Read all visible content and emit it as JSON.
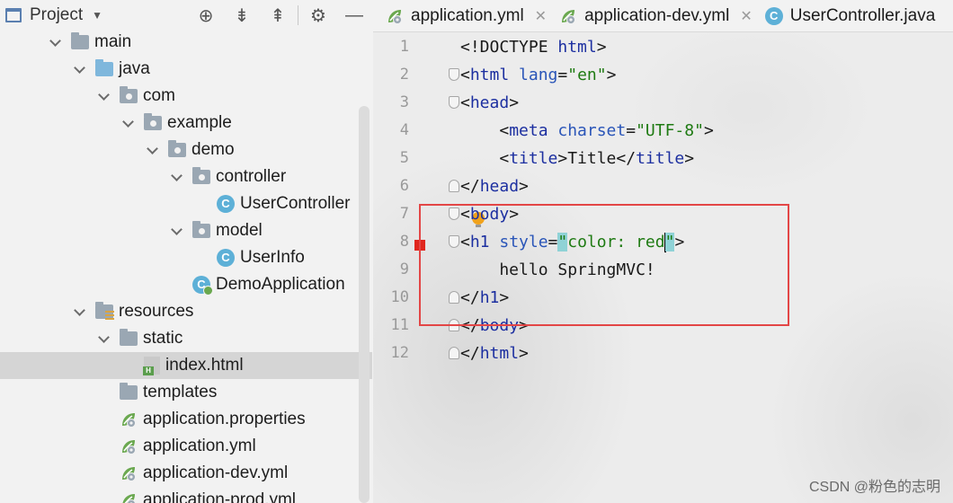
{
  "project_panel": {
    "title": "Project",
    "tree": [
      {
        "label": "main",
        "icon": "folder-icon",
        "indent": 1,
        "expanded": true
      },
      {
        "label": "java",
        "icon": "source-folder-icon",
        "indent": 2,
        "expanded": true
      },
      {
        "label": "com",
        "icon": "package-icon",
        "indent": 3,
        "expanded": true
      },
      {
        "label": "example",
        "icon": "package-icon",
        "indent": 4,
        "expanded": true
      },
      {
        "label": "demo",
        "icon": "package-icon",
        "indent": 5,
        "expanded": true
      },
      {
        "label": "controller",
        "icon": "package-icon",
        "indent": 6,
        "expanded": true
      },
      {
        "label": "UserController",
        "icon": "class-icon",
        "indent": 7
      },
      {
        "label": "model",
        "icon": "package-icon",
        "indent": 6,
        "expanded": true
      },
      {
        "label": "UserInfo",
        "icon": "class-icon",
        "indent": 7
      },
      {
        "label": "DemoApplication",
        "icon": "spring-boot-class-icon",
        "indent": 6
      },
      {
        "label": "resources",
        "icon": "resources-folder-icon",
        "indent": 2,
        "expanded": true
      },
      {
        "label": "static",
        "icon": "folder-icon",
        "indent": 3,
        "expanded": true
      },
      {
        "label": "index.html",
        "icon": "html-file-icon",
        "indent": 4,
        "selected": true
      },
      {
        "label": "templates",
        "icon": "folder-icon",
        "indent": 3
      },
      {
        "label": "application.properties",
        "icon": "spring-config-icon",
        "indent": 3
      },
      {
        "label": "application.yml",
        "icon": "spring-config-icon",
        "indent": 3
      },
      {
        "label": "application-dev.yml",
        "icon": "spring-config-icon",
        "indent": 3
      },
      {
        "label": "application-prod.yml",
        "icon": "spring-config-icon",
        "indent": 3
      }
    ]
  },
  "editor": {
    "tabs": [
      {
        "label": "application.yml",
        "icon": "spring-config-icon"
      },
      {
        "label": "application-dev.yml",
        "icon": "spring-config-icon"
      },
      {
        "label": "UserController.java",
        "icon": "class-icon"
      }
    ],
    "line_numbers": [
      "1",
      "2",
      "3",
      "4",
      "5",
      "6",
      "7",
      "8",
      "9",
      "10",
      "11",
      "12"
    ],
    "code": {
      "l1_a": "<!DOCTYPE ",
      "l1_b": "html",
      "l1_c": ">",
      "l2_a": "<",
      "l2_b": "html ",
      "l2_c": "lang",
      "l2_d": "=",
      "l2_e": "\"en\"",
      "l2_f": ">",
      "l3_a": "<",
      "l3_b": "head",
      "l3_c": ">",
      "l4_a": "    <",
      "l4_b": "meta ",
      "l4_c": "charset",
      "l4_d": "=",
      "l4_e": "\"UTF-8\"",
      "l4_f": ">",
      "l5_a": "    <",
      "l5_b": "title",
      "l5_c": ">Title</",
      "l5_d": "title",
      "l5_e": ">",
      "l6_a": "</",
      "l6_b": "head",
      "l6_c": ">",
      "l7_a": "<",
      "l7_b": "body",
      "l7_c": ">",
      "l8_a": "<",
      "l8_b": "h1 ",
      "l8_c": "style",
      "l8_d": "=",
      "l8_e": "\"",
      "l8_f": "color: red",
      "l8_g": "\"",
      "l8_h": ">",
      "l9": "    hello SpringMVC!",
      "l10_a": "</",
      "l10_b": "h1",
      "l10_c": ">",
      "l11_a": "</",
      "l11_b": "body",
      "l11_c": ">",
      "l12_a": "</",
      "l12_b": "html",
      "l12_c": ">"
    }
  },
  "watermark": "CSDN @粉色的志明"
}
